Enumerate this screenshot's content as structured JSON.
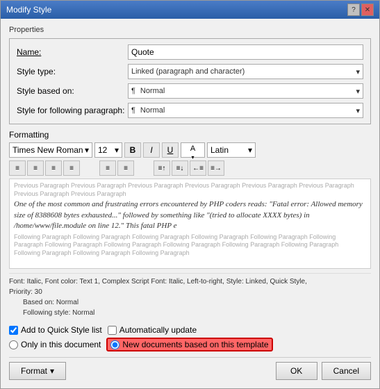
{
  "dialog": {
    "title": "Modify Style",
    "title_btn_help": "?",
    "title_btn_close": "✕"
  },
  "properties": {
    "section_label": "Properties",
    "name_label": "Name:",
    "name_value": "Quote",
    "style_type_label": "Style type:",
    "style_type_value": "Linked (paragraph and character)",
    "style_based_label": "Style based on:",
    "style_based_value": "Normal",
    "style_following_label": "Style for following paragraph:",
    "style_following_value": "Normal"
  },
  "formatting": {
    "section_label": "Formatting",
    "font_name": "Times New Roman",
    "font_size": "12",
    "bold_label": "B",
    "italic_label": "I",
    "underline_label": "U",
    "color_label": "color",
    "latin_label": "Latin"
  },
  "preview": {
    "prev_paragraph": "Previous Paragraph Previous Paragraph Previous Paragraph Previous Paragraph Previous Paragraph Previous Paragraph Previous Paragraph Previous Paragraph",
    "main_text": "One of the most common and frustrating errors encountered by PHP coders reads: \"Fatal error: Allowed memory size of 8388608 bytes exhausted...\" followed by something like \"(tried to allocate XXXX bytes) in /home/www/file.module on line 12.\" This fatal PHP e",
    "follow_paragraph": "Following Paragraph Following Paragraph Following Paragraph Following Paragraph Following Paragraph Following Paragraph Following Paragraph Following Paragraph Following Paragraph Following Paragraph Following Paragraph Following Paragraph Following Paragraph Following Paragraph"
  },
  "style_info": {
    "line1": "Font: Italic, Font color: Text 1, Complex Script Font: Italic, Left-to-right, Style: Linked, Quick Style,",
    "line2": "Priority: 30",
    "based_on": "Based on: Normal",
    "following": "Following style: Normal"
  },
  "options": {
    "add_to_quick_style": "Add to Quick Style list",
    "auto_update": "Automatically update",
    "only_in_document": "Only in this document",
    "new_documents": "New documents based on this template"
  },
  "footer": {
    "format_label": "Format",
    "format_arrow": "▾",
    "ok_label": "OK",
    "cancel_label": "Cancel"
  }
}
